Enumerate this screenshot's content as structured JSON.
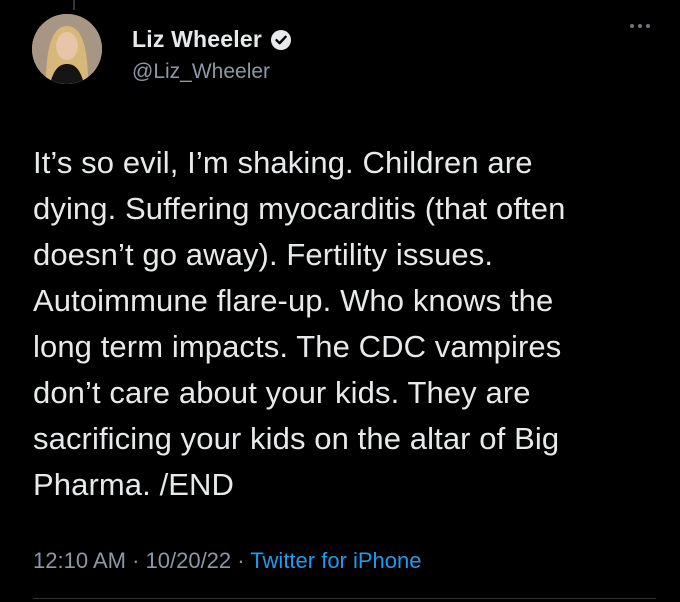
{
  "author": {
    "display_name": "Liz Wheeler",
    "handle": "@Liz_Wheeler",
    "verified_icon": "verified-badge-icon"
  },
  "tweet": {
    "text": "It’s so evil, I’m shaking. Children are\ndying. Suffering myocarditis (that often\ndoesn’t go away). Fertility issues.\nAutoimmune flare-up. Who knows the\nlong term impacts. The CDC vampires\ndon’t care about your kids. They are\nsacrificing your kids on the altar of Big\nPharma. /END"
  },
  "meta": {
    "time": "12:10 AM",
    "sep1": " · ",
    "date": "10/20/22",
    "sep2": " · ",
    "source": "Twitter for iPhone"
  },
  "colors": {
    "background": "#000000",
    "text": "#e7e9ea",
    "secondary": "#8b98a5",
    "accent": "#1d9bf0"
  }
}
